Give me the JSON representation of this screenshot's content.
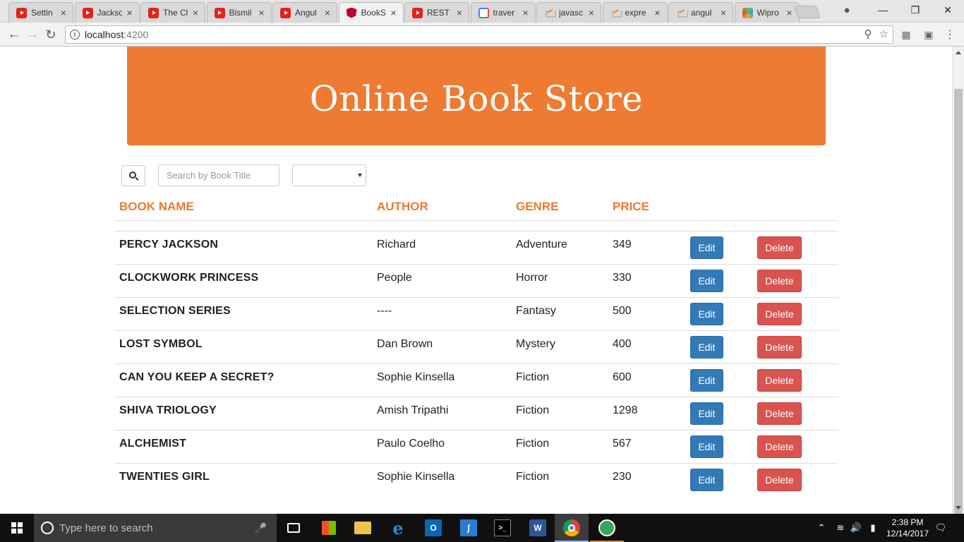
{
  "browser": {
    "tabs": [
      {
        "title": "Settin",
        "favicon": "youtube-icon"
      },
      {
        "title": "Jackso",
        "favicon": "youtube-icon"
      },
      {
        "title": "The Cl",
        "favicon": "youtube-icon"
      },
      {
        "title": "Bismil",
        "favicon": "youtube-icon"
      },
      {
        "title": "Angul",
        "favicon": "youtube-icon"
      },
      {
        "title": "BookS",
        "favicon": "angular-icon"
      },
      {
        "title": "REST",
        "favicon": "youtube-icon"
      },
      {
        "title": "traver",
        "favicon": "google-icon"
      },
      {
        "title": "javasc",
        "favicon": "stackoverflow-icon"
      },
      {
        "title": "expre",
        "favicon": "stackoverflow-icon"
      },
      {
        "title": "angul",
        "favicon": "stackoverflow-icon"
      },
      {
        "title": "Wipro",
        "favicon": "wipro-icon"
      }
    ],
    "active_tab": "BookS",
    "address": {
      "host": "localhost",
      "port": ":4200"
    }
  },
  "page": {
    "banner_title": "Online Book Store",
    "search": {
      "placeholder": "Search by Book Title",
      "value": ""
    },
    "genre_filter": {
      "selected": ""
    },
    "columns": [
      "BOOK NAME",
      "AUTHOR",
      "GENRE",
      "PRICE"
    ],
    "edit_label": "Edit",
    "delete_label": "Delete",
    "books": [
      {
        "name": "PERCY JACKSON",
        "author": "Richard",
        "genre": "Adventure",
        "price": "349"
      },
      {
        "name": "CLOCKWORK PRINCESS",
        "author": "People",
        "genre": "Horror",
        "price": "330"
      },
      {
        "name": "SELECTION SERIES",
        "author": "----",
        "genre": "Fantasy",
        "price": "500"
      },
      {
        "name": "LOST SYMBOL",
        "author": "Dan Brown",
        "genre": "Mystery",
        "price": "400"
      },
      {
        "name": "CAN YOU KEEP A SECRET?",
        "author": "Sophie Kinsella",
        "genre": "Fiction",
        "price": "600"
      },
      {
        "name": "SHIVA TRIOLOGY",
        "author": "Amish Tripathi",
        "genre": "Fiction",
        "price": "1298"
      },
      {
        "name": "ALCHEMIST",
        "author": "Paulo Coelho",
        "genre": "Fiction",
        "price": "567"
      },
      {
        "name": "TWENTIES GIRL",
        "author": "Sophie Kinsella",
        "genre": "Fiction",
        "price": "230"
      }
    ]
  },
  "colors": {
    "accent": "#ef7a31",
    "edit_button": "#337ab7",
    "delete_button": "#d9534f"
  },
  "taskbar": {
    "search_placeholder": "Type here to search",
    "time": "2:38 PM",
    "date": "12/14/2017"
  }
}
